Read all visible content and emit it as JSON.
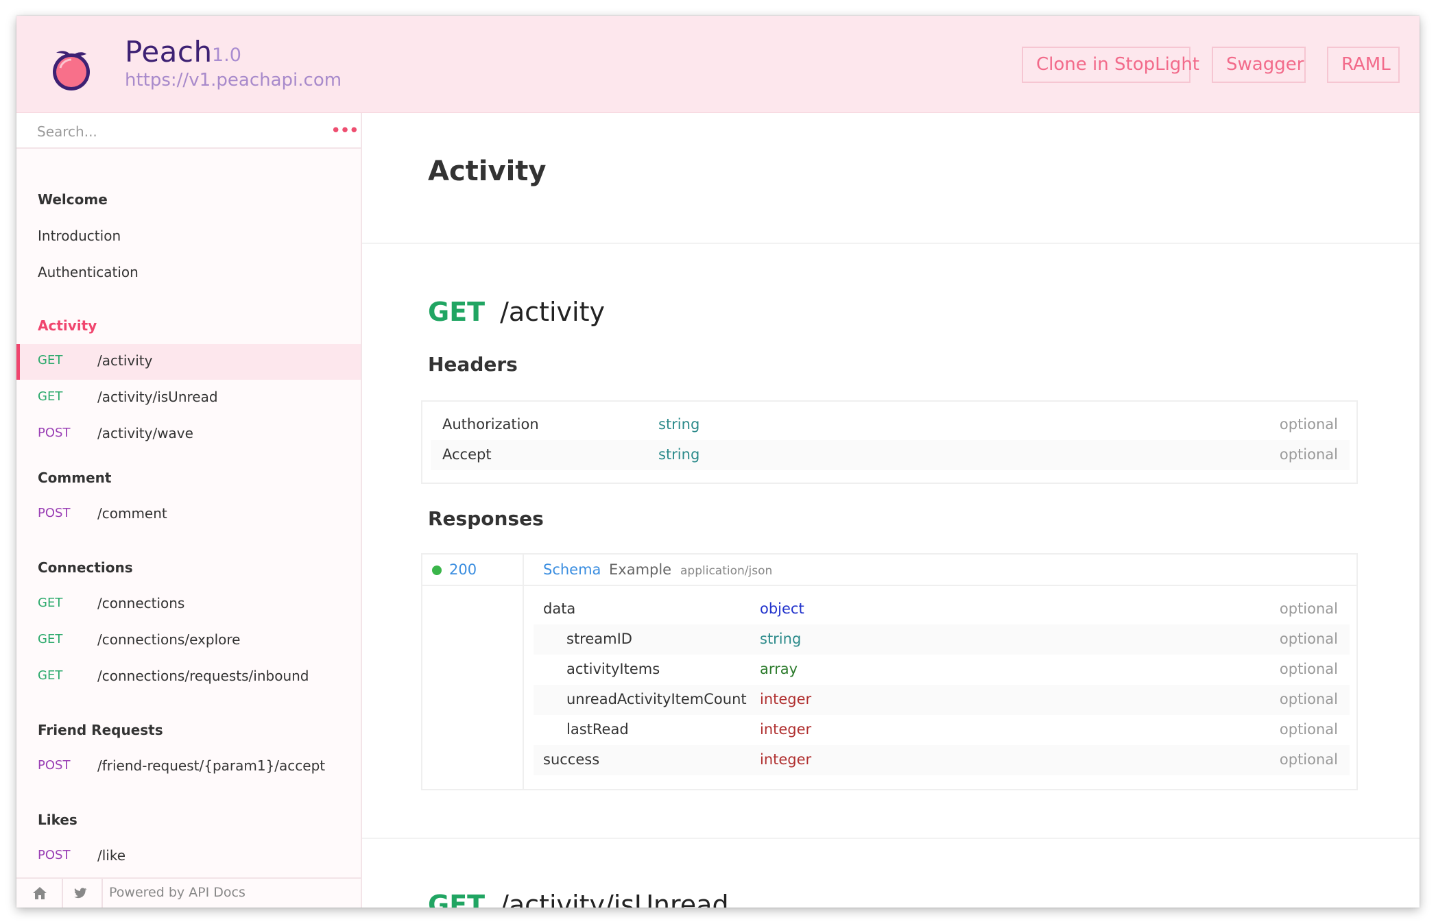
{
  "header": {
    "name": "Peach",
    "version": "1.0",
    "url": "https://v1.peachapi.com",
    "buttons": {
      "clone": "Clone in StopLight",
      "swagger": "Swagger",
      "raml": "RAML"
    }
  },
  "sidebar": {
    "search_placeholder": "Search...",
    "more_icon": "•••",
    "sections": [
      {
        "title": "Welcome",
        "links": [
          "Introduction",
          "Authentication"
        ]
      },
      {
        "title": "Activity",
        "endpoints": [
          {
            "method": "GET",
            "path": "/activity"
          },
          {
            "method": "GET",
            "path": "/activity/isUnread"
          },
          {
            "method": "POST",
            "path": "/activity/wave"
          }
        ]
      },
      {
        "title": "Comment",
        "endpoints": [
          {
            "method": "POST",
            "path": "/comment"
          }
        ]
      },
      {
        "title": "Connections",
        "endpoints": [
          {
            "method": "GET",
            "path": "/connections"
          },
          {
            "method": "GET",
            "path": "/connections/explore"
          },
          {
            "method": "GET",
            "path": "/connections/requests/inbound"
          }
        ]
      },
      {
        "title": "Friend Requests",
        "endpoints": [
          {
            "method": "POST",
            "path": "/friend-request/{param1}/accept"
          }
        ]
      },
      {
        "title": "Likes",
        "endpoints": [
          {
            "method": "POST",
            "path": "/like"
          }
        ]
      }
    ],
    "footer": {
      "powered_by": "Powered by API Docs",
      "home_icon": "home-icon",
      "twitter_icon": "twitter-icon"
    }
  },
  "main": {
    "page_title": "Activity",
    "endpoint1": {
      "method": "GET",
      "path": "/activity",
      "headers_title": "Headers",
      "headers": [
        {
          "name": "Authorization",
          "type": "string",
          "req": "optional"
        },
        {
          "name": "Accept",
          "type": "string",
          "req": "optional"
        }
      ],
      "responses_title": "Responses",
      "response": {
        "code": "200",
        "tabs": {
          "schema": "Schema",
          "example": "Example",
          "mime": "application/json"
        },
        "fields": [
          {
            "name": "data",
            "type": "object",
            "req": "optional"
          },
          {
            "name": "streamID",
            "type": "string",
            "req": "optional"
          },
          {
            "name": "activityItems",
            "type": "array",
            "req": "optional"
          },
          {
            "name": "unreadActivityItemCount",
            "type": "integer",
            "req": "optional"
          },
          {
            "name": "lastRead",
            "type": "integer",
            "req": "optional"
          },
          {
            "name": "success",
            "type": "integer",
            "req": "optional"
          }
        ]
      }
    },
    "endpoint2": {
      "method": "GET",
      "path": "/activity/isUnread"
    }
  }
}
